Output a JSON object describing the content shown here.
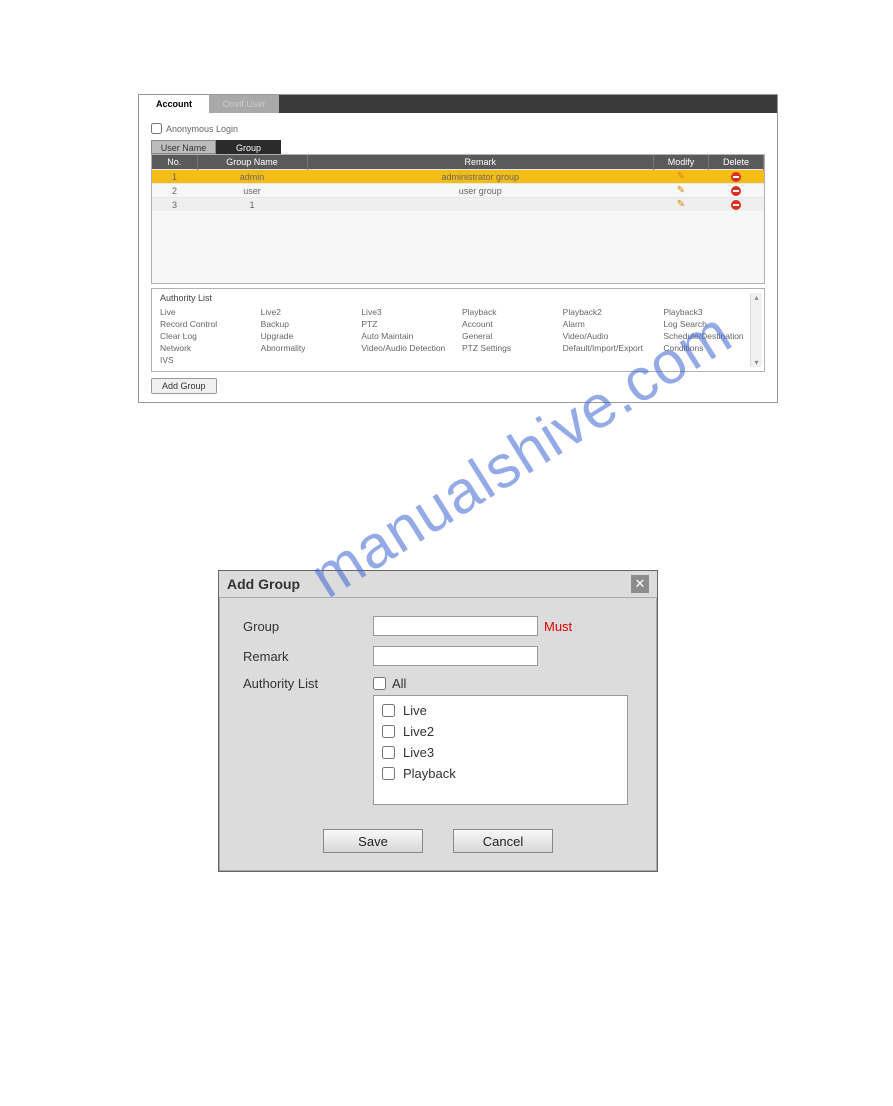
{
  "watermark": "manualshive.com",
  "panel1": {
    "tabs": {
      "account": "Account",
      "onvif": "Onvif User"
    },
    "anonymous_label": "Anonymous Login",
    "sub_tabs": {
      "username": "User Name",
      "group": "Group"
    },
    "headers": {
      "no": "No.",
      "group_name": "Group Name",
      "remark": "Remark",
      "modify": "Modify",
      "delete": "Delete"
    },
    "rows": [
      {
        "no": "1",
        "name": "admin",
        "remark": "administrator group"
      },
      {
        "no": "2",
        "name": "user",
        "remark": "user group"
      },
      {
        "no": "3",
        "name": "1",
        "remark": ""
      }
    ],
    "authority_title": "Authority List",
    "authority": [
      "Live",
      "Live2",
      "Live3",
      "Playback",
      "Playback2",
      "Playback3",
      "Record Control",
      "Backup",
      "PTZ",
      "Account",
      "Alarm",
      "Log Search",
      "Clear Log",
      "Upgrade",
      "Auto Maintain",
      "General",
      "Video/Audio",
      "Schedule/Destination",
      "Network",
      "Abnormality",
      "Video/Audio Detection",
      "PTZ Settings",
      "Default/Import/Export",
      "Conditions",
      "IVS"
    ],
    "add_group_btn": "Add Group"
  },
  "dialog": {
    "title": "Add Group",
    "labels": {
      "group": "Group",
      "remark": "Remark",
      "authority": "Authority List",
      "all": "All",
      "must": "Must"
    },
    "options": [
      "Live",
      "Live2",
      "Live3",
      "Playback"
    ],
    "buttons": {
      "save": "Save",
      "cancel": "Cancel"
    }
  }
}
